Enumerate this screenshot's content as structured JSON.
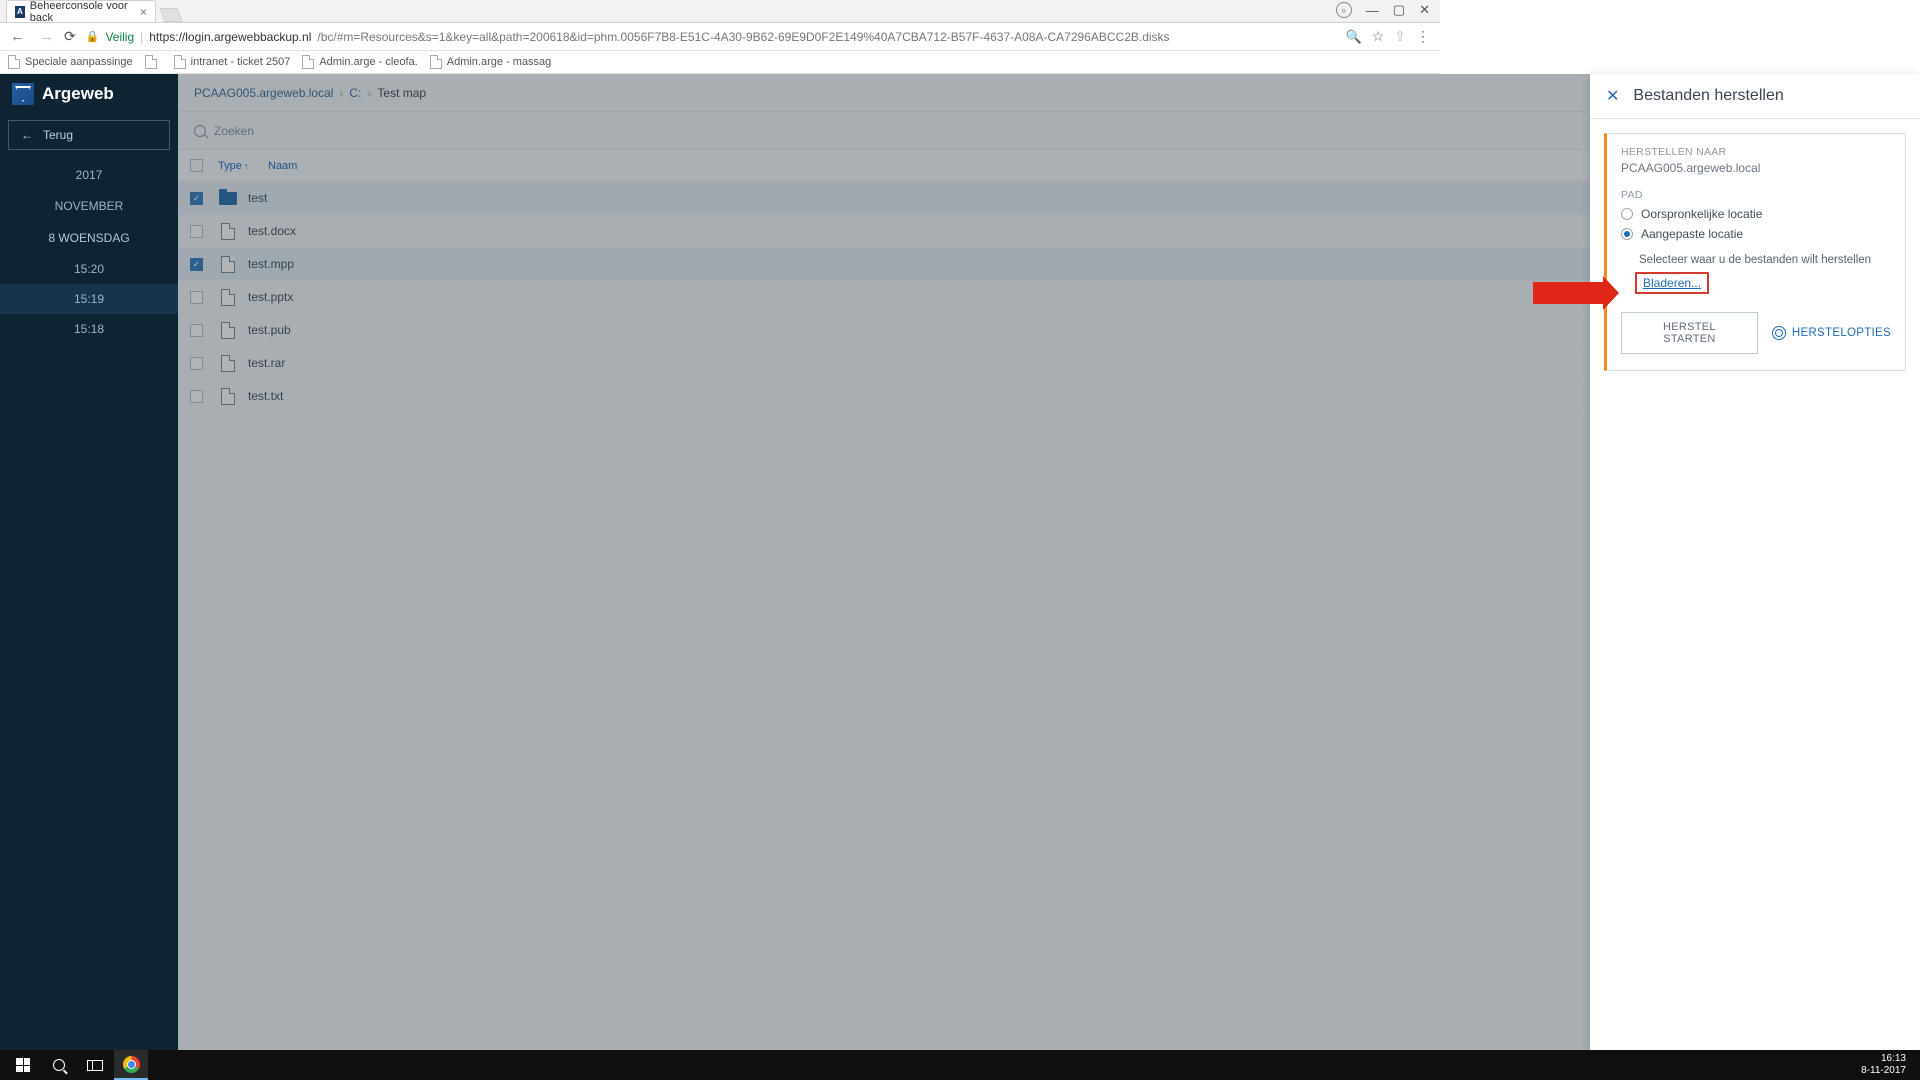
{
  "browser": {
    "tab_title": "Beheerconsole voor back",
    "secure_label": "Veilig",
    "url_host": "https://login.argewebbackup.nl",
    "url_path": "/bc/#m=Resources&s=1&key=all&path=200618&id=phm.0056F7B8-E51C-4A30-9B62-69E9D0F2E149%40A7CBA712-B57F-4637-A08A-CA7296ABCC2B.disks",
    "bookmarks": [
      "Speciale aanpassinge",
      "",
      "intranet - ticket 2507",
      "Admin.arge - cleofa.",
      "Admin.arge - massag"
    ]
  },
  "brand": "Argeweb",
  "back_label": "Terug",
  "sidebar": {
    "year": "2017",
    "month": "NOVEMBER",
    "day": "8 WOENSDAG",
    "times": [
      "15:20",
      "15:19",
      "15:18"
    ],
    "active_index": 1
  },
  "breadcrumb": [
    "PCAAG005.argeweb.local",
    "C:",
    "Test map"
  ],
  "search_placeholder": "Zoeken",
  "columns": {
    "type": "Type",
    "name": "Naam"
  },
  "files": [
    {
      "name": "test",
      "kind": "folder",
      "selected": true
    },
    {
      "name": "test.docx",
      "kind": "file",
      "selected": false
    },
    {
      "name": "test.mpp",
      "kind": "file",
      "selected": true
    },
    {
      "name": "test.pptx",
      "kind": "file",
      "selected": false
    },
    {
      "name": "test.pub",
      "kind": "file",
      "selected": false
    },
    {
      "name": "test.rar",
      "kind": "file",
      "selected": false
    },
    {
      "name": "test.txt",
      "kind": "file",
      "selected": false
    }
  ],
  "panel": {
    "title": "Bestanden herstellen",
    "restore_to_label": "HERSTELLEN NAAR",
    "restore_to_value": "PCAAG005.argeweb.local",
    "path_label": "PAD",
    "opt_original": "Oorspronkelijke locatie",
    "opt_custom": "Aangepaste locatie",
    "hint": "Selecteer waar u de bestanden wilt herstellen",
    "browse": "Bladeren...",
    "start": "HERSTEL STARTEN",
    "options": "HERSTELOPTIES"
  },
  "taskbar": {
    "time": "16:13",
    "date": "8-11-2017"
  }
}
